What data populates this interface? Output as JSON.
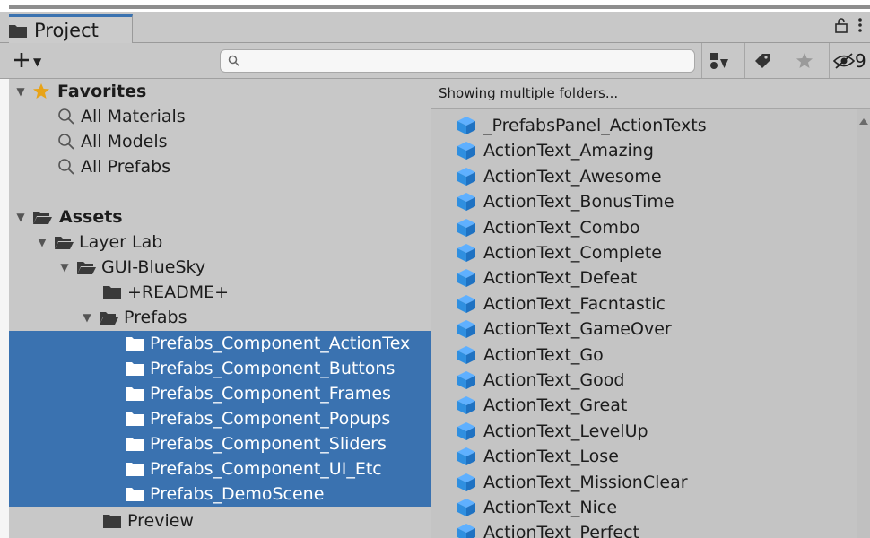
{
  "window": {
    "tab_title": "Project",
    "hidden_count": "9"
  },
  "toolbar": {
    "search_placeholder": "",
    "search_value": ""
  },
  "favorites": {
    "label": "Favorites",
    "items": [
      "All Materials",
      "All Models",
      "All Prefabs"
    ]
  },
  "assets": {
    "label": "Assets",
    "layer_lab": "Layer Lab",
    "gui_bluesky": "GUI-BlueSky",
    "readme": "+README+",
    "prefabs": "Prefabs",
    "prefab_folders": [
      "Prefabs_Component_ActionTex",
      "Prefabs_Component_Buttons",
      "Prefabs_Component_Frames",
      "Prefabs_Component_Popups",
      "Prefabs_Component_Sliders",
      "Prefabs_Component_UI_Etc",
      "Prefabs_DemoScene"
    ],
    "preview": "Preview"
  },
  "content": {
    "path_label": "Showing multiple folders...",
    "items": [
      "_PrefabsPanel_ActionTexts",
      "ActionText_Amazing",
      "ActionText_Awesome",
      "ActionText_BonusTime",
      "ActionText_Combo",
      "ActionText_Complete",
      "ActionText_Defeat",
      "ActionText_Facntastic",
      "ActionText_GameOver",
      "ActionText_Go",
      "ActionText_Good",
      "ActionText_Great",
      "ActionText_LevelUp",
      "ActionText_Lose",
      "ActionText_MissionClear",
      "ActionText_Nice",
      "ActionText_Perfect"
    ]
  },
  "colors": {
    "selection": "#3a72b0",
    "prefab_blue": "#2f8fe0",
    "star": "#e8a317",
    "panel": "#c8c8c8"
  }
}
